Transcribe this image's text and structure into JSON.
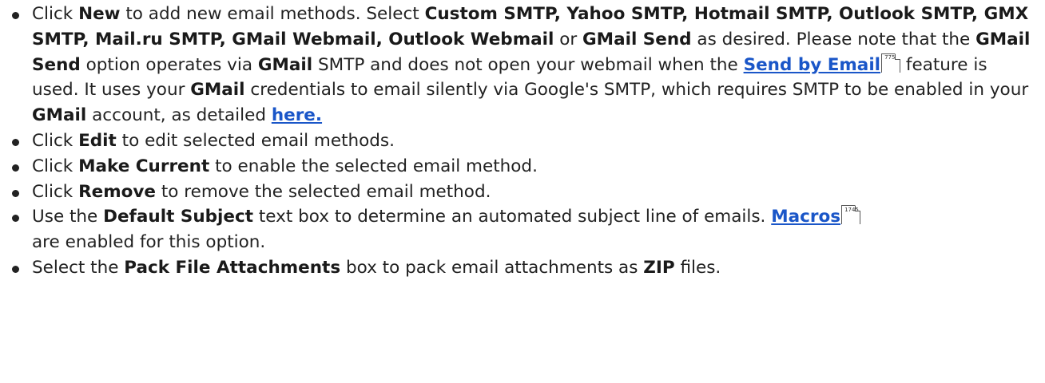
{
  "items": [
    {
      "t0": "Click ",
      "b0": "New",
      "t1": " to add new email methods. Select ",
      "b1": "Custom SMTP, Yahoo SMTP, Hotmail SMTP, Outlook SMTP, GMX SMTP, Mail.ru SMTP, GMail Webmail, Outlook Webmail",
      "t2": " or ",
      "b2": "GMail Send",
      "t3": " as desired. Please note that the ",
      "b3": "GMail Send",
      "t4": " option operates via ",
      "b4": "GMail",
      "t5": " SMTP and does not open your webmail when the ",
      "link1": "Send by Email",
      "page1": "775",
      "t6": " feature is used. It uses your ",
      "b5": "GMail",
      "t7": " credentials to email silently via Google's SMTP, which requires SMTP to be enabled in your ",
      "b6": "GMail",
      "t8": " account, as detailed ",
      "link2": "here."
    },
    {
      "t0": "Click ",
      "b0": "Edit",
      "t1": " to edit selected email methods."
    },
    {
      "t0": "Click ",
      "b0": "Make Current",
      "t1": " to enable the selected email method."
    },
    {
      "t0": "Click ",
      "b0": "Remove",
      "t1": " to remove the selected email method."
    },
    {
      "t0": "Use the ",
      "b0": "Default Subject",
      "t1": " text box to determine an automated subject line of emails. ",
      "link1": "Macros",
      "page1": "1745",
      "t2": " are enabled for this option."
    },
    {
      "t0": "Select the ",
      "b0": "Pack File Attachments",
      "t1": " box to pack email attachments as ",
      "b1": "ZIP",
      "t2": " files."
    }
  ]
}
